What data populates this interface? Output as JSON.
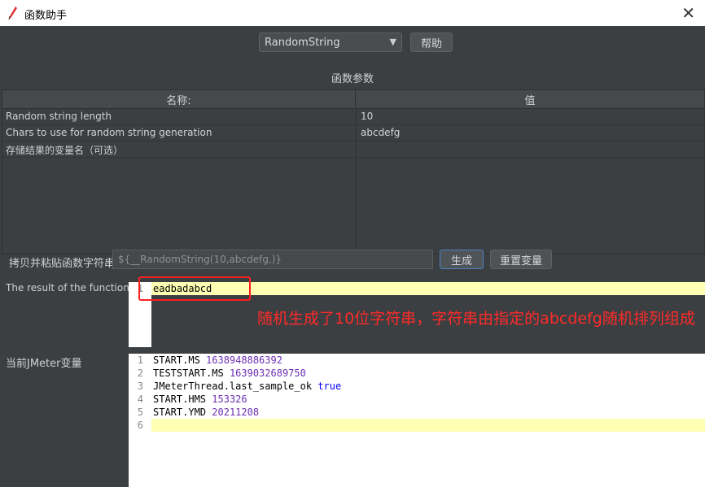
{
  "window": {
    "title": "函数助手"
  },
  "function_select": {
    "value": "RandomString"
  },
  "help_button": "帮助",
  "params": {
    "title": "函数参数",
    "col_name": "名称:",
    "col_value": "值",
    "rows": [
      {
        "name": "Random string length",
        "value": "10"
      },
      {
        "name": "Chars to use for random string generation",
        "value": "abcdefg"
      },
      {
        "name": "存储结果的变量名（可选）",
        "value": ""
      }
    ]
  },
  "copy": {
    "label": "拷贝并粘贴函数字符串",
    "value": "${__RandomString(10,abcdefg,)}",
    "generate_button": "生成",
    "reset_button": "重置变量"
  },
  "result": {
    "label": "The result of the function is",
    "line_no": "1",
    "value": "eadbadabcd"
  },
  "annotation": {
    "text": "随机生成了10位字符串，字符串由指定的abcdefg随机排列组成"
  },
  "vars": {
    "label": "当前JMeter变量",
    "lines": [
      {
        "no": "1",
        "key": "START.MS",
        "val": "1638948886392"
      },
      {
        "no": "2",
        "key": "TESTSTART.MS",
        "val": "1639032689750"
      },
      {
        "no": "3",
        "key": "JMeterThread.last_sample_ok",
        "val": "true"
      },
      {
        "no": "4",
        "key": "START.HMS",
        "val": "153326"
      },
      {
        "no": "5",
        "key": "START.YMD",
        "val": "20211208"
      },
      {
        "no": "6",
        "key": "",
        "val": ""
      }
    ]
  },
  "colors": {
    "annotation": "#ff2a2a",
    "highlight": "#ffffb3",
    "value_purple": "#6b2fb3",
    "keyword_blue": "#0000ff"
  },
  "icons": {
    "app": "feather-icon",
    "close": "close-icon",
    "dropdown": "chevron-down-icon"
  }
}
